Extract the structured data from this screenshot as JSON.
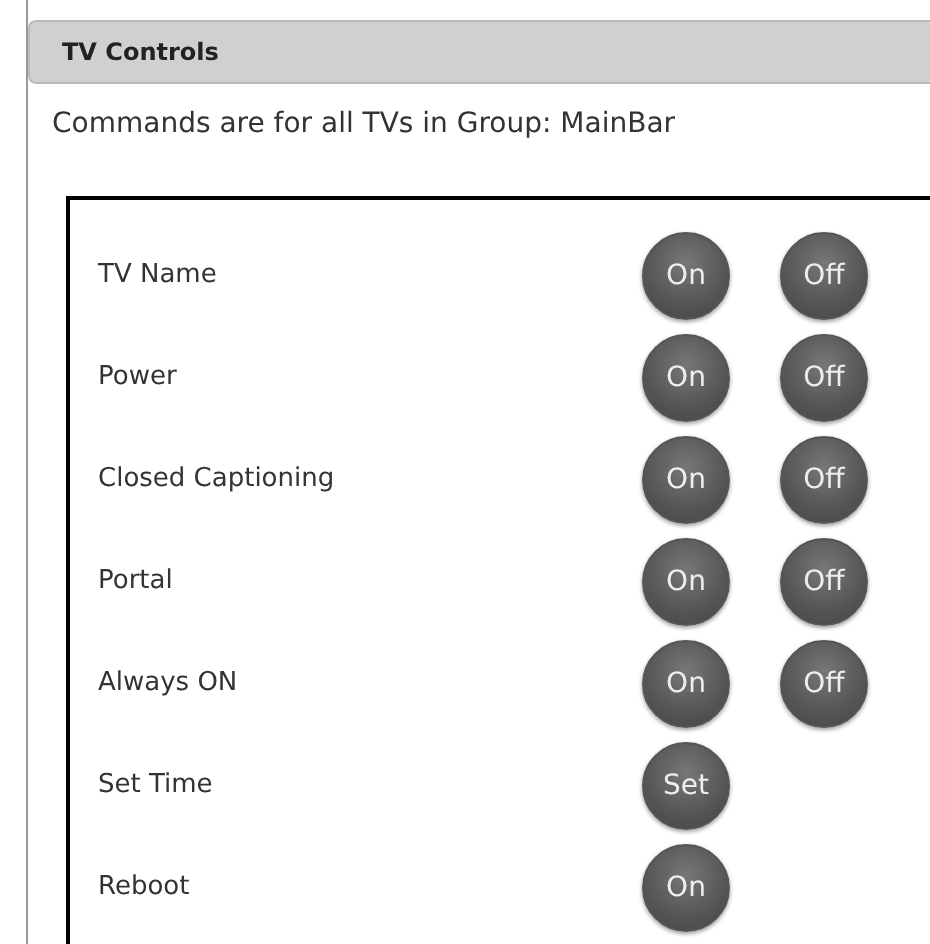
{
  "panel": {
    "title": "TV Controls",
    "description": "Commands are for all TVs in Group: MainBar"
  },
  "commands": [
    {
      "label": "TV Name",
      "buttons": [
        "On",
        "Off"
      ]
    },
    {
      "label": "Power",
      "buttons": [
        "On",
        "Off"
      ]
    },
    {
      "label": "Closed Captioning",
      "buttons": [
        "On",
        "Off"
      ]
    },
    {
      "label": "Portal",
      "buttons": [
        "On",
        "Off"
      ]
    },
    {
      "label": "Always ON",
      "buttons": [
        "On",
        "Off"
      ]
    },
    {
      "label": "Set Time",
      "buttons": [
        "Set"
      ]
    },
    {
      "label": "Reboot",
      "buttons": [
        "On"
      ]
    }
  ]
}
